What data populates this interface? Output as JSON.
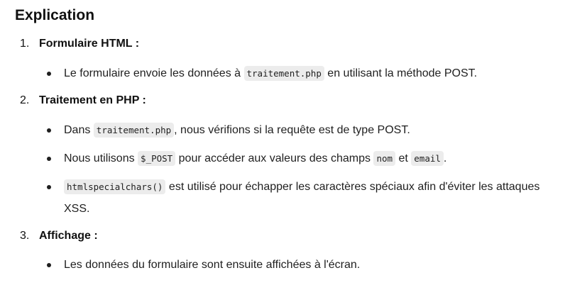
{
  "heading": "Explication",
  "sections": [
    {
      "number": "1.",
      "label": "Formulaire HTML :",
      "bullets": [
        {
          "parts": [
            {
              "t": "Le formulaire envoie les données à "
            },
            {
              "c": "traitement.php"
            },
            {
              "t": " en utilisant la méthode POST."
            }
          ]
        }
      ]
    },
    {
      "number": "2.",
      "label": "Traitement en PHP :",
      "bullets": [
        {
          "parts": [
            {
              "t": "Dans "
            },
            {
              "c": "traitement.php"
            },
            {
              "t": ", nous vérifions si la requête est de type POST."
            }
          ]
        },
        {
          "parts": [
            {
              "t": "Nous utilisons "
            },
            {
              "c": "$_POST"
            },
            {
              "t": " pour accéder aux valeurs des champs "
            },
            {
              "c": "nom"
            },
            {
              "t": " et "
            },
            {
              "c": "email"
            },
            {
              "t": "."
            }
          ]
        },
        {
          "parts": [
            {
              "c": "htmlspecialchars()"
            },
            {
              "t": " est utilisé pour échapper les caractères spéciaux afin d'éviter les attaques XSS."
            }
          ]
        }
      ]
    },
    {
      "number": "3.",
      "label": "Affichage :",
      "bullets": [
        {
          "parts": [
            {
              "t": "Les données du formulaire sont ensuite affichées à l'écran."
            }
          ]
        }
      ]
    }
  ]
}
